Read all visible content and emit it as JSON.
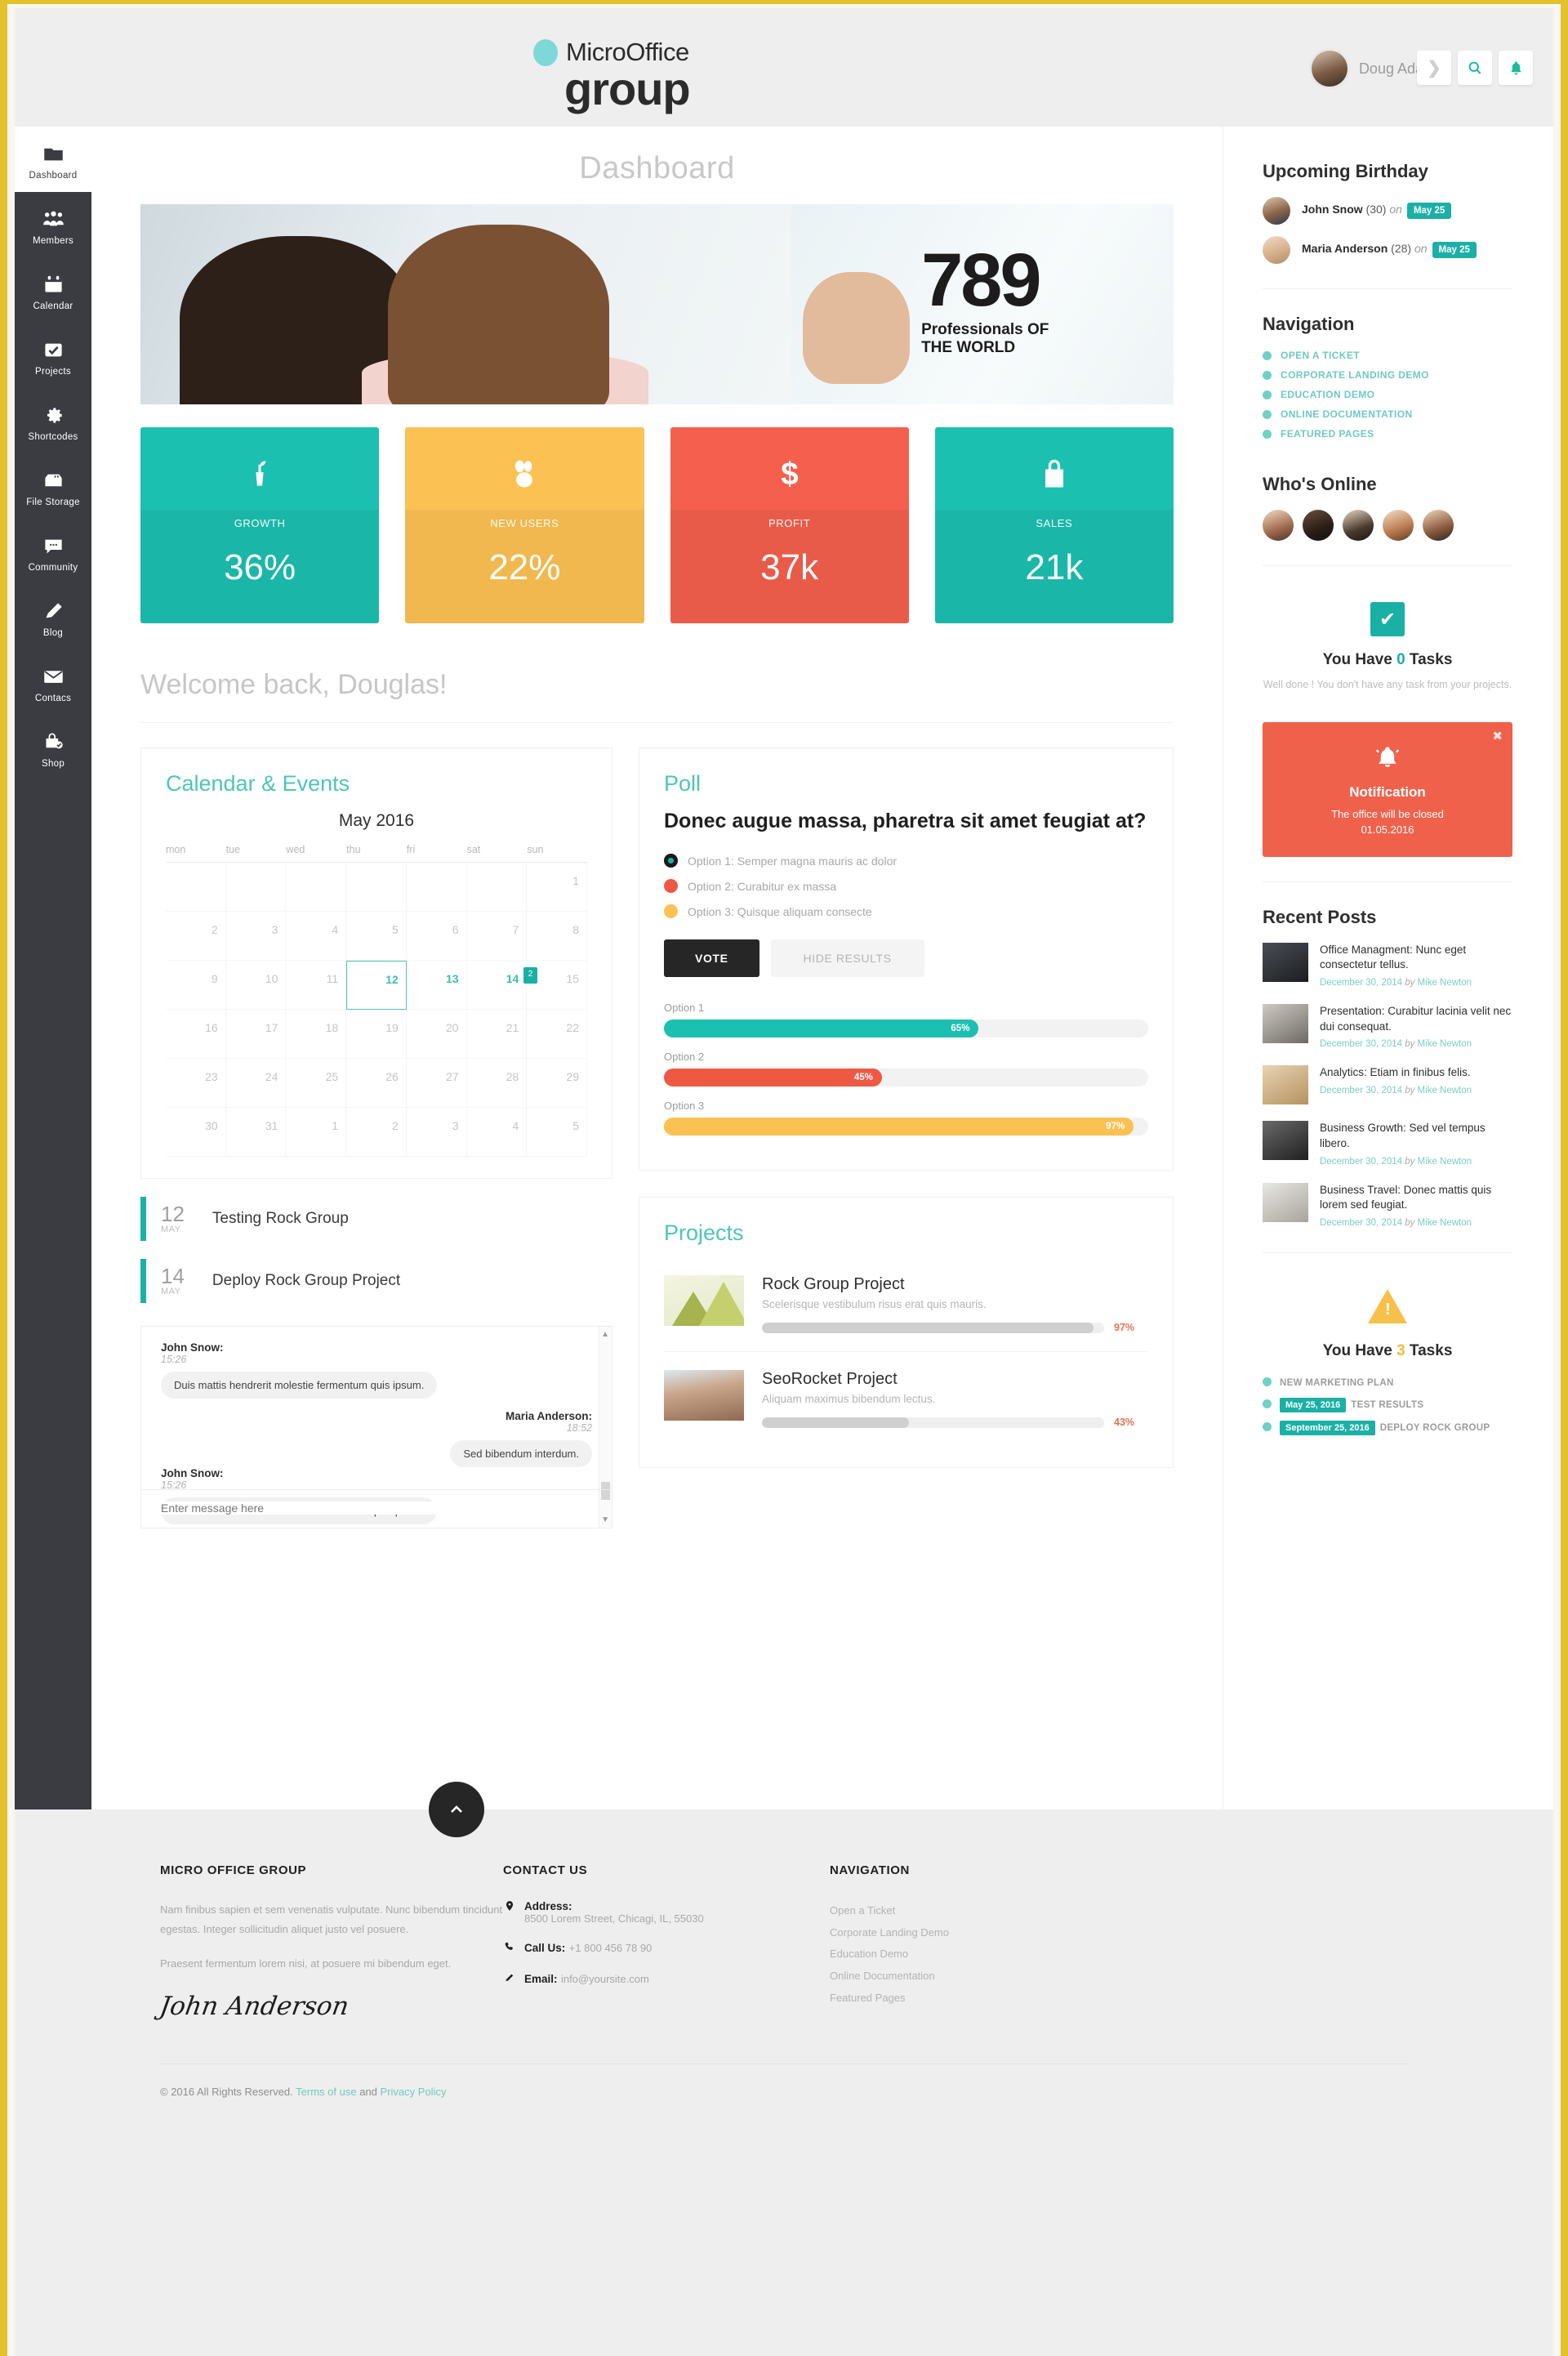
{
  "brand": {
    "micro": "MicroOffice",
    "group": "group"
  },
  "topbar": {
    "user_name": "Doug Adams",
    "icons": {
      "next": "›",
      "search": "⌕",
      "bell": "🔔"
    }
  },
  "sidebar": {
    "items": [
      {
        "label": "Dashboard",
        "icon": "folder-icon",
        "active": true
      },
      {
        "label": "Members",
        "icon": "members-icon"
      },
      {
        "label": "Calendar",
        "icon": "calendar-icon"
      },
      {
        "label": "Projects",
        "icon": "check-icon"
      },
      {
        "label": "Shortcodes",
        "icon": "gear-icon"
      },
      {
        "label": "File Storage",
        "icon": "drawer-icon"
      },
      {
        "label": "Community",
        "icon": "chat-icon"
      },
      {
        "label": "Blog",
        "icon": "pencil-icon"
      },
      {
        "label": "Contacs",
        "icon": "envelope-icon"
      },
      {
        "label": "Shop",
        "icon": "bag-icon"
      }
    ]
  },
  "page": {
    "title": "Dashboard",
    "welcome": "Welcome back, Douglas!"
  },
  "hero": {
    "counter": "789",
    "sub1": "Professionals OF",
    "sub2": "THE WORLD"
  },
  "stats": [
    {
      "label": "GROWTH",
      "value": "36%",
      "color": "#1cc0b0",
      "icon": "plant-icon"
    },
    {
      "label": "NEW USERS",
      "value": "22%",
      "color": "#fbc153",
      "icon": "users-icon"
    },
    {
      "label": "PROFIT",
      "value": "37k",
      "color": "#f4604d",
      "icon": "dollar-icon"
    },
    {
      "label": "SALES",
      "value": "21k",
      "color": "#1cc0b0",
      "icon": "bag-icon"
    }
  ],
  "calendar": {
    "heading": "Calendar & Events",
    "month": "May 2016",
    "weekdays": [
      "mon",
      "tue",
      "wed",
      "thu",
      "fri",
      "sat",
      "sun"
    ],
    "weeks": [
      [
        {
          "d": ""
        },
        {
          "d": ""
        },
        {
          "d": ""
        },
        {
          "d": ""
        },
        {
          "d": ""
        },
        {
          "d": ""
        },
        {
          "d": "1"
        }
      ],
      [
        {
          "d": "2"
        },
        {
          "d": "3"
        },
        {
          "d": "4"
        },
        {
          "d": "5"
        },
        {
          "d": "6"
        },
        {
          "d": "7"
        },
        {
          "d": "8"
        }
      ],
      [
        {
          "d": "9"
        },
        {
          "d": "10"
        },
        {
          "d": "11"
        },
        {
          "d": "12",
          "sel": true
        },
        {
          "d": "13",
          "hl": true
        },
        {
          "d": "14",
          "hl": true,
          "badge": "2"
        },
        {
          "d": "15"
        }
      ],
      [
        {
          "d": "16"
        },
        {
          "d": "17"
        },
        {
          "d": "18"
        },
        {
          "d": "19"
        },
        {
          "d": "20"
        },
        {
          "d": "21"
        },
        {
          "d": "22"
        }
      ],
      [
        {
          "d": "23"
        },
        {
          "d": "24"
        },
        {
          "d": "25"
        },
        {
          "d": "26"
        },
        {
          "d": "27"
        },
        {
          "d": "28"
        },
        {
          "d": "29"
        }
      ],
      [
        {
          "d": "30"
        },
        {
          "d": "31"
        },
        {
          "d": "1"
        },
        {
          "d": "2"
        },
        {
          "d": "3"
        },
        {
          "d": "4"
        },
        {
          "d": "5"
        }
      ]
    ],
    "events": [
      {
        "day": "12",
        "month": "MAY",
        "title": "Testing Rock Group"
      },
      {
        "day": "14",
        "month": "MAY",
        "title": "Deploy Rock Group Project"
      }
    ]
  },
  "chat": {
    "messages": [
      {
        "name": "John Snow:",
        "time": "15:26",
        "text": "Duis mattis hendrerit molestie fermentum quis ipsum.",
        "side": "left"
      },
      {
        "name": "Maria Anderson:",
        "time": "18:52",
        "text": "Sed bibendum interdum.",
        "side": "right"
      },
      {
        "name": "John Snow:",
        "time": "15:26",
        "text": "Duis mattis hendrerit molestie fermentum quis ipsum.",
        "side": "left"
      }
    ],
    "input_placeholder": "Enter message here"
  },
  "poll": {
    "heading": "Poll",
    "question": "Donec augue massa, pharetra sit amet feugiat at?",
    "options": [
      {
        "label": "Option 1: Semper magna mauris ac dolor",
        "color": "#1bb0a6",
        "selected": true
      },
      {
        "label": "Option 2: Curabitur ex massa",
        "color": "#ef5843",
        "selected": false
      },
      {
        "label": "Option 3: Quisque aliquam consecte",
        "color": "#fbc153",
        "selected": false
      }
    ],
    "vote_label": "VOTE",
    "hide_label": "HIDE RESULTS",
    "results": [
      {
        "label": "Option 1",
        "pct": 65,
        "text": "65%",
        "color": "#1cc0b0"
      },
      {
        "label": "Option 2",
        "pct": 45,
        "text": "45%",
        "color": "#ef5843"
      },
      {
        "label": "Option 3",
        "pct": 97,
        "text": "97%",
        "color": "#fbc153"
      }
    ]
  },
  "projects": {
    "heading": "Projects",
    "items": [
      {
        "name": "Rock Group Project",
        "desc": "Scelerisque vestibulum risus erat quis mauris.",
        "pct": 97,
        "pct_text": "97%",
        "thumb": "mountain-thumb"
      },
      {
        "name": "SeoRocket Project",
        "desc": "Aliquam maximus bibendum lectus.",
        "pct": 43,
        "pct_text": "43%",
        "thumb": "portrait-thumb"
      }
    ]
  },
  "rail": {
    "birthday_heading": "Upcoming Birthday",
    "birthdays": [
      {
        "name": "John Snow",
        "age": "(30)",
        "on": "on",
        "date": "May 25",
        "gender": "m"
      },
      {
        "name": "Maria Anderson",
        "age": "(28)",
        "on": "on",
        "date": "May 25",
        "gender": "f"
      }
    ],
    "nav_heading": "Navigation",
    "nav_items": [
      "OPEN A TICKET",
      "CORPORATE LANDING DEMO",
      "EDUCATION DEMO",
      "ONLINE DOCUMENTATION",
      "FEATURED PAGES"
    ],
    "online_heading": "Who's Online",
    "tasks_zero": {
      "title_pre": "You Have ",
      "count": "0",
      "title_post": " Tasks",
      "sub": "Well done ! You don't have any task from your projects."
    },
    "notification": {
      "title": "Notification",
      "line1": "The office will be closed",
      "line2": "01.05.2016",
      "close": "✖"
    },
    "posts_heading": "Recent Posts",
    "posts": [
      {
        "title": "Office Managment: Nunc eget consectetur tellus.",
        "date": "December 30, 2014",
        "by": "by",
        "author": "Mike Newton",
        "thumb": "p1"
      },
      {
        "title": "Presentation: Curabitur lacinia velit nec dui consequat.",
        "date": "December 30, 2014",
        "by": "by",
        "author": "Mike Newton",
        "thumb": "p2"
      },
      {
        "title": "Analytics: Etiam in finibus felis.",
        "date": "December 30, 2014",
        "by": "by",
        "author": "Mike Newton",
        "thumb": "p3"
      },
      {
        "title": "Business Growth: Sed vel tempus libero.",
        "date": "December 30, 2014",
        "by": "by",
        "author": "Mike Newton",
        "thumb": "p4"
      },
      {
        "title": "Business Travel: Donec mattis quis lorem sed feugiat.",
        "date": "December 30, 2014",
        "by": "by",
        "author": "Mike Newton",
        "thumb": "p5"
      }
    ],
    "tasks_three": {
      "title_pre": "You Have ",
      "count": "3",
      "title_post": " Tasks",
      "items": [
        {
          "chip": "",
          "label": "NEW MARKETING PLAN"
        },
        {
          "chip": "May 25, 2016",
          "label": "TEST RESULTS"
        },
        {
          "chip": "September 25, 2016",
          "label": "DEPLOY ROCK GROUP"
        }
      ]
    }
  },
  "scroll_top_icon": "⌃",
  "footer": {
    "col1_heading": "MICRO OFFICE GROUP",
    "col1_p1": "Nam finibus sapien et sem venenatis vulputate. Nunc bibendum tincidunt egestas. Integer sollicitudin aliquet justo vel posuere.",
    "col1_p2": "Praesent fermentum lorem nisi, at posuere mi bibendum eget.",
    "signature": "John Anderson",
    "col2_heading": "CONTACT US",
    "address_label": "Address:",
    "address_value": "8500 Lorem Street, Chicagi, IL, 55030",
    "call_label": "Call Us:",
    "call_value": "+1 800 456 78 90",
    "email_label": "Email:",
    "email_value": "info@yoursite.com",
    "col3_heading": "NAVIGATION",
    "nav": [
      "Open a Ticket",
      "Corporate Landing Demo",
      "Education Demo",
      "Online Documentation",
      "Featured Pages"
    ],
    "copyright": "© 2016 All Rights Reserved.",
    "terms": "Terms of use",
    "and": "and",
    "privacy": "Privacy Policy"
  }
}
